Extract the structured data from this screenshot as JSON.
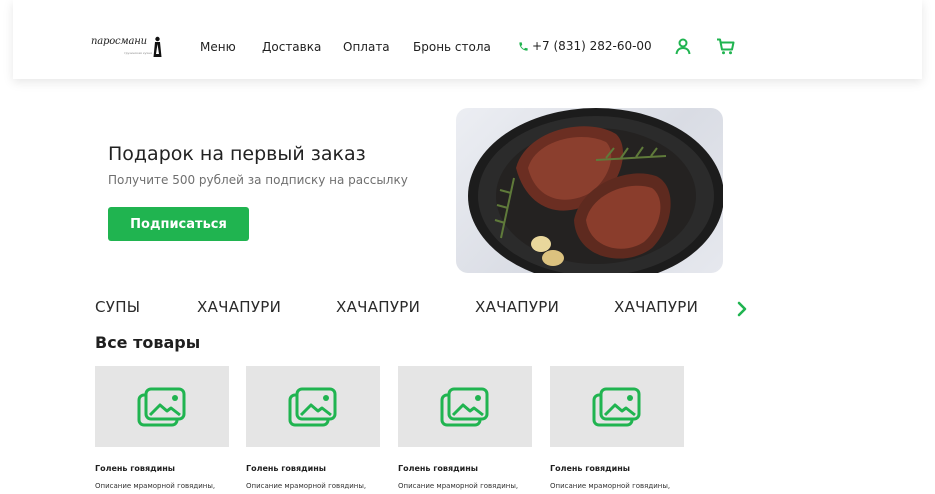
{
  "brand": {
    "name": "паросмани",
    "tagline": "грузинская кухня"
  },
  "nav": {
    "items": [
      {
        "label": "Меню"
      },
      {
        "label": "Доставка"
      },
      {
        "label": "Оплата"
      },
      {
        "label": "Бронь стола"
      }
    ],
    "phone": "+7 (831) 282-60-00"
  },
  "icons": {
    "phone": "phone-icon",
    "profile": "user-icon",
    "cart": "cart-icon",
    "next": "chevron-right-icon",
    "placeholder": "image-placeholder-icon"
  },
  "colors": {
    "accent": "#20b450",
    "placeholder_bg": "#e5e5e5",
    "text": "#1f1f1f"
  },
  "hero": {
    "title": "Подарок на первый заказ",
    "subtitle": "Получите 500 рублей за подписку на рассылку",
    "button_label": "Подписаться"
  },
  "categories": [
    {
      "label": "СУПЫ"
    },
    {
      "label": "ХАЧАПУРИ"
    },
    {
      "label": "ХАЧАПУРИ"
    },
    {
      "label": "ХАЧАПУРИ"
    },
    {
      "label": "ХАЧАПУРИ"
    }
  ],
  "products_section": {
    "title": "Все товары",
    "items": [
      {
        "name": "Голень говядины",
        "description": "Описание мраморной говядины,"
      },
      {
        "name": "Голень говядины",
        "description": "Описание мраморной говядины,"
      },
      {
        "name": "Голень говядины",
        "description": "Описание мраморной говядины,"
      },
      {
        "name": "Голень говядины",
        "description": "Описание мраморной говядины,"
      }
    ]
  }
}
